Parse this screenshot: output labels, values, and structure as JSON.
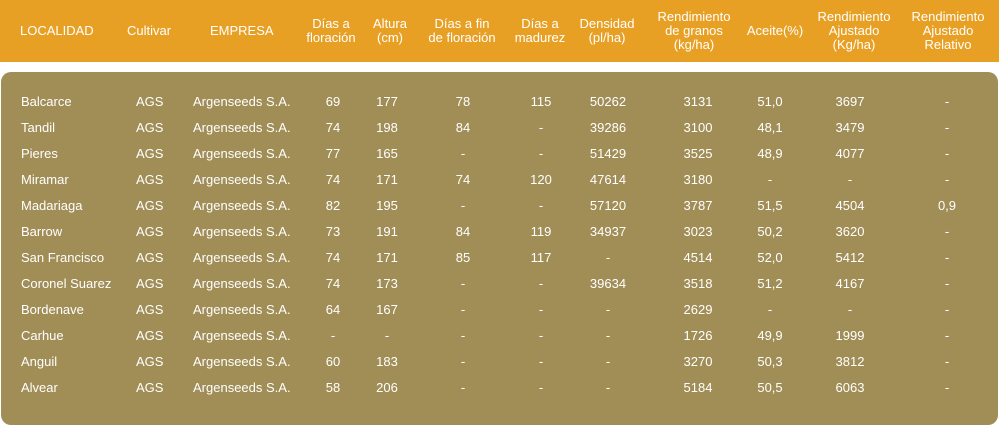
{
  "table": {
    "headers": [
      "LOCALIDAD",
      "Cultivar",
      "EMPRESA",
      "Días a\nfloración",
      "Altura\n(cm)",
      "Días a fin\nde floración",
      "Días a\nmadurez",
      "Densidad\n(pl/ha)",
      "Rendimiento\nde granos\n(kg/ha)",
      "Aceite(%)",
      "Rendimiento\nAjustado\n(Kg/ha)",
      "Rendimiento\nAjustado\nRelativo"
    ],
    "rows": [
      [
        "Balcarce",
        "AGS",
        "Argenseeds S.A.",
        "69",
        "177",
        "78",
        "115",
        "50262",
        "3131",
        "51,0",
        "3697",
        "-"
      ],
      [
        "Tandil",
        "AGS",
        "Argenseeds S.A.",
        "74",
        "198",
        "84",
        "-",
        "39286",
        "3100",
        "48,1",
        "3479",
        "-"
      ],
      [
        "Pieres",
        "AGS",
        "Argenseeds S.A.",
        "77",
        "165",
        "-",
        "-",
        "51429",
        "3525",
        "48,9",
        "4077",
        "-"
      ],
      [
        "Miramar",
        "AGS",
        "Argenseeds S.A.",
        "74",
        "171",
        "74",
        "120",
        "47614",
        "3180",
        "-",
        "-",
        "-"
      ],
      [
        "Madariaga",
        "AGS",
        "Argenseeds S.A.",
        "82",
        "195",
        "-",
        "-",
        "57120",
        "3787",
        "51,5",
        "4504",
        "0,9"
      ],
      [
        "Barrow",
        "AGS",
        "Argenseeds S.A.",
        "73",
        "191",
        "84",
        "119",
        "34937",
        "3023",
        "50,2",
        "3620",
        "-"
      ],
      [
        "San Francisco",
        "AGS",
        "Argenseeds S.A.",
        "74",
        "171",
        "85",
        "117",
        "-",
        "4514",
        "52,0",
        "5412",
        "-"
      ],
      [
        "Coronel Suarez",
        "AGS",
        "Argenseeds S.A.",
        "74",
        "173",
        "-",
        "-",
        "39634",
        "3518",
        "51,2",
        "4167",
        "-"
      ],
      [
        "Bordenave",
        "AGS",
        "Argenseeds S.A.",
        "64",
        "167",
        "-",
        "-",
        "-",
        "2629",
        "-",
        "-",
        "-"
      ],
      [
        "Carhue",
        "AGS",
        "Argenseeds S.A.",
        "-",
        "-",
        "-",
        "-",
        "-",
        "1726",
        "49,9",
        "1999",
        "-"
      ],
      [
        "Anguil",
        "AGS",
        "Argenseeds S.A.",
        "60",
        "183",
        "-",
        "-",
        "-",
        "3270",
        "50,3",
        "3812",
        "-"
      ],
      [
        "Alvear",
        "AGS",
        "Argenseeds S.A.",
        "58",
        "206",
        "-",
        "-",
        "-",
        "5184",
        "50,5",
        "6063",
        "-"
      ]
    ]
  }
}
